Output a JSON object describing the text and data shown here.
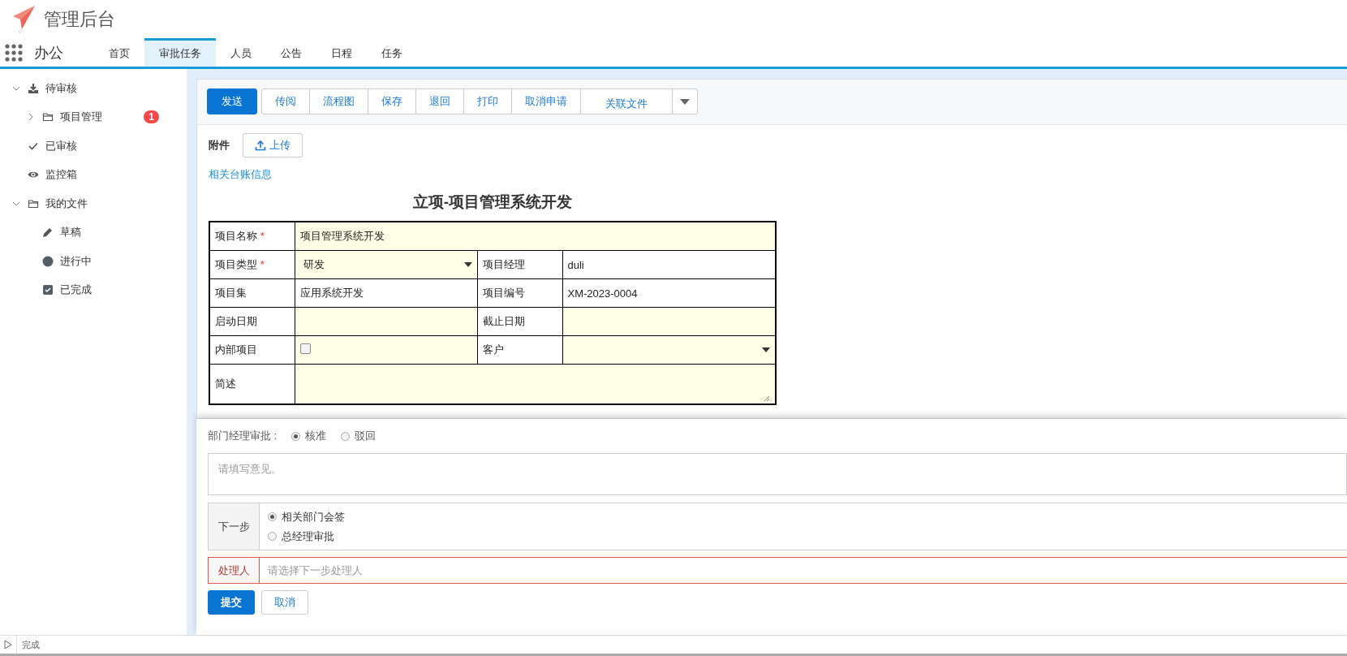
{
  "header": {
    "title": "管理后台"
  },
  "nav": {
    "module": "办公",
    "tabs": [
      {
        "label": "首页",
        "selected": false
      },
      {
        "label": "审批任务",
        "selected": true
      },
      {
        "label": "人员",
        "selected": false
      },
      {
        "label": "公告",
        "selected": false
      },
      {
        "label": "日程",
        "selected": false
      },
      {
        "label": "任务",
        "selected": false
      }
    ]
  },
  "sidebar": {
    "items": [
      {
        "label": "待审核",
        "kind": "download",
        "expanded": true,
        "children": [
          {
            "label": "项目管理",
            "kind": "folder",
            "expanded": false,
            "badge": "1"
          }
        ]
      },
      {
        "label": "已审核",
        "kind": "check"
      },
      {
        "label": "监控箱",
        "kind": "eye"
      },
      {
        "label": "我的文件",
        "kind": "folder",
        "expanded": true,
        "children": [
          {
            "label": "草稿",
            "kind": "pencil"
          },
          {
            "label": "进行中",
            "kind": "dot"
          },
          {
            "label": "已完成",
            "kind": "checkbox"
          }
        ]
      }
    ]
  },
  "toolbar": {
    "buttons": [
      {
        "label": "发送",
        "kind": "primary"
      },
      {
        "label": "传阅",
        "kind": "default"
      },
      {
        "label": "流程图",
        "kind": "default"
      },
      {
        "label": "保存",
        "kind": "default"
      },
      {
        "label": "退回",
        "kind": "default"
      },
      {
        "label": "打印",
        "kind": "default"
      },
      {
        "label": "取消申请",
        "kind": "default"
      },
      {
        "label": "关联文件",
        "kind": "wide"
      }
    ]
  },
  "attachments": {
    "label": "附件",
    "upload": "上传"
  },
  "ledger_link": "相关台账信息",
  "form": {
    "title": "立项-项目管理系统开发",
    "rows": [
      [
        {
          "label": "项目名称",
          "required_mark": "*",
          "kind": "text",
          "value": "项目管理系统开发",
          "editable": true
        }
      ],
      [
        {
          "label": "项目类型",
          "required_mark": "*",
          "kind": "select",
          "value": "研发",
          "editable": true
        },
        {
          "label": "项目经理",
          "kind": "text",
          "value": "duli",
          "editable": false
        }
      ],
      [
        {
          "label": "项目集",
          "kind": "text",
          "value": "应用系统开发",
          "editable": false
        },
        {
          "label": "项目编号",
          "kind": "text",
          "value": "XM-2023-0004",
          "editable": false
        }
      ],
      [
        {
          "label": "启动日期",
          "kind": "text",
          "editable": true
        },
        {
          "label": "截止日期",
          "kind": "text",
          "editable": true
        }
      ],
      [
        {
          "label": "内部项目",
          "kind": "checkbox",
          "checked": false,
          "editable": true
        },
        {
          "label": "客户",
          "kind": "select",
          "editable": true
        }
      ],
      [
        {
          "label": "简述",
          "kind": "textarea",
          "editable": true
        }
      ]
    ]
  },
  "approval": {
    "label": "部门经理审批 :",
    "options": [
      {
        "label": "核准",
        "selected": true
      },
      {
        "label": "驳回",
        "selected": false
      }
    ],
    "opinion": {
      "placeholder": "请填写意见。"
    },
    "next_step": {
      "label": "下一步",
      "options": [
        {
          "label": "相关部门会签",
          "selected": true
        },
        {
          "label": "总经理审批",
          "selected": false
        }
      ]
    },
    "handler": {
      "label": "处理人",
      "placeholder": "请选择下一步处理人"
    },
    "buttons": [
      {
        "label": "提交",
        "kind": "primary"
      },
      {
        "label": "取消",
        "kind": "default"
      }
    ]
  },
  "status_bar": {
    "text": "完成"
  }
}
